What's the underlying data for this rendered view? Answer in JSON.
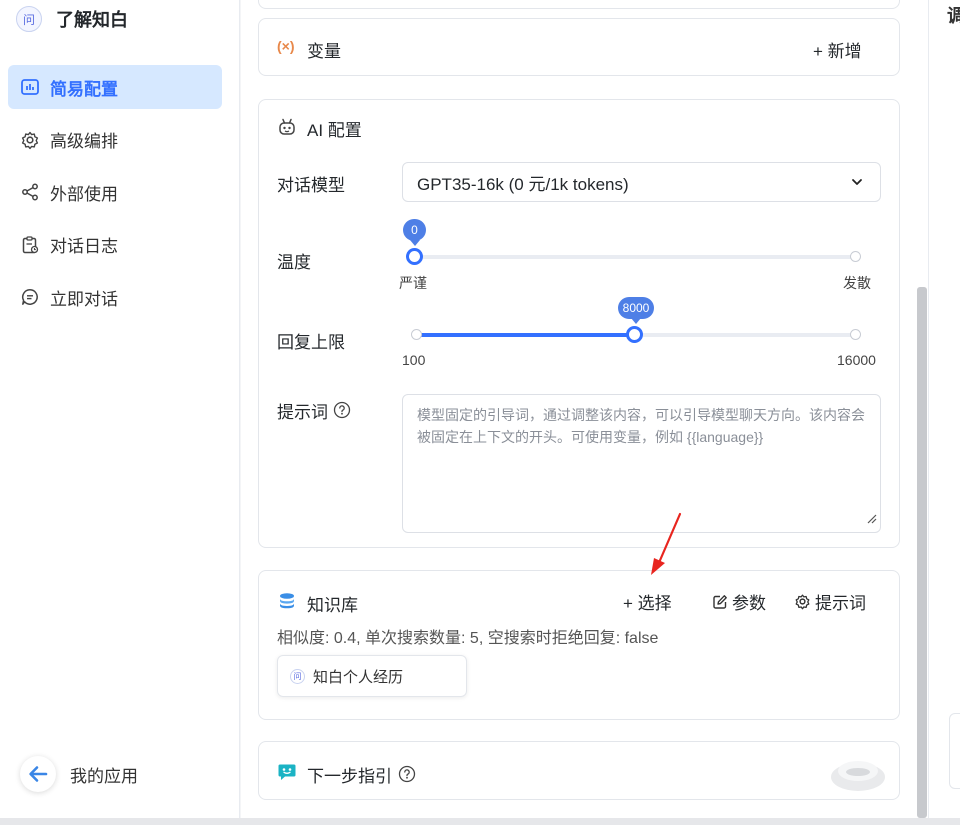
{
  "brand": {
    "name": "了解知白",
    "logo_glyph": "问"
  },
  "sidebar": {
    "items": [
      {
        "label": "简易配置",
        "icon": "bar-chart-icon",
        "active": true
      },
      {
        "label": "高级编排",
        "icon": "gear-icon",
        "active": false
      },
      {
        "label": "外部使用",
        "icon": "share-icon",
        "active": false
      },
      {
        "label": "对话日志",
        "icon": "clipboard-log-icon",
        "active": false
      },
      {
        "label": "立即对话",
        "icon": "chat-bubble-icon",
        "active": false
      }
    ],
    "my_apps_label": "我的应用"
  },
  "variables": {
    "title": "变量",
    "icon_glyph": "(×)",
    "add_label": "+ 新增"
  },
  "ai_config": {
    "title": "AI 配置",
    "model_label": "对话模型",
    "model_value": "GPT35-16k (0 元/1k tokens)",
    "temperature": {
      "label": "温度",
      "value": "0",
      "value_fraction": 0,
      "min_label": "严谨",
      "max_label": "发散"
    },
    "max_tokens": {
      "label": "回复上限",
      "value": "8000",
      "value_fraction": 0.5,
      "min_label": "100",
      "max_label": "16000"
    },
    "prompt_label": "提示词",
    "prompt_placeholder": "模型固定的引导词，通过调整该内容，可以引导模型聊天方向。该内容会被固定在上下文的开头。可使用变量，例如 {{language}}"
  },
  "knowledge": {
    "title": "知识库",
    "select_label": "+ 选择",
    "params_label": "参数",
    "prompt_label": "提示词",
    "summary": "相似度: 0.4, 单次搜索数量: 5, 空搜索时拒绝回复: false",
    "dataset_name": "知白个人经历",
    "dataset_glyph": "问"
  },
  "next_guide": {
    "title": "下一步指引"
  },
  "right_panel_glyph": "调",
  "colors": {
    "accent": "#3370ff",
    "active_bg": "#d6e8ff",
    "arrow": "#e8251f",
    "variable_icon": "#e8884a",
    "kb_icon": "#3a8ee6",
    "guide_icon": "#1bb3c4"
  }
}
